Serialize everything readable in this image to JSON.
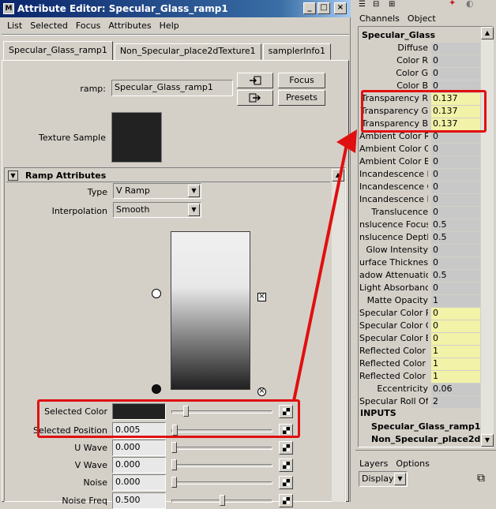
{
  "window": {
    "title": "Attribute Editor: Specular_Glass_ramp1",
    "caption_buttons": [
      "_",
      "□",
      "×"
    ]
  },
  "menu": [
    "List",
    "Selected",
    "Focus",
    "Attributes",
    "Help"
  ],
  "tabs": [
    "Specular_Glass_ramp1",
    "Non_Specular_place2dTexture1",
    "samplerInfo1"
  ],
  "node": {
    "name_label": "ramp:",
    "name_value": "Specular_Glass_ramp1",
    "focus_label": "Focus",
    "presets_label": "Presets",
    "texture_sample_label": "Texture Sample"
  },
  "ramp_attributes": {
    "section_title": "Ramp Attributes",
    "type_label": "Type",
    "type_value": "V Ramp",
    "interpolation_label": "Interpolation",
    "interpolation_value": "Smooth"
  },
  "sliders": [
    {
      "label": "Selected Color",
      "value": "",
      "fraction": 0.12
    },
    {
      "label": "Selected Position",
      "value": "0.005",
      "fraction": 0.005
    },
    {
      "label": "U Wave",
      "value": "0.000",
      "fraction": 0
    },
    {
      "label": "V Wave",
      "value": "0.000",
      "fraction": 0
    },
    {
      "label": "Noise",
      "value": "0.000",
      "fraction": 0
    },
    {
      "label": "Noise Freq",
      "value": "0.500",
      "fraction": 0.5
    }
  ],
  "channel_box": {
    "menu": [
      "Channels",
      "Object"
    ],
    "node_name": "Specular_Glass",
    "channels": [
      {
        "name": "Diffuse",
        "value": "0",
        "hl": false
      },
      {
        "name": "Color R",
        "value": "0",
        "hl": false
      },
      {
        "name": "Color G",
        "value": "0",
        "hl": false
      },
      {
        "name": "Color B",
        "value": "0",
        "hl": false
      },
      {
        "name": "Transparency R",
        "value": "0.137",
        "hl": true
      },
      {
        "name": "Transparency G",
        "value": "0.137",
        "hl": true
      },
      {
        "name": "Transparency B",
        "value": "0.137",
        "hl": true
      },
      {
        "name": "Ambient Color R",
        "value": "0",
        "hl": false
      },
      {
        "name": "Ambient Color G",
        "value": "0",
        "hl": false
      },
      {
        "name": "Ambient Color B",
        "value": "0",
        "hl": false
      },
      {
        "name": "Incandescence R",
        "value": "0",
        "hl": false
      },
      {
        "name": "Incandescence G",
        "value": "0",
        "hl": false
      },
      {
        "name": "Incandescence B",
        "value": "0",
        "hl": false
      },
      {
        "name": "Translucence",
        "value": "0",
        "hl": false
      },
      {
        "name": "nslucence Focus",
        "value": "0.5",
        "hl": false
      },
      {
        "name": "nslucence Depth",
        "value": "0.5",
        "hl": false
      },
      {
        "name": "Glow Intensity",
        "value": "0",
        "hl": false
      },
      {
        "name": "urface Thickness",
        "value": "0",
        "hl": false
      },
      {
        "name": "adow Attenuation",
        "value": "0.5",
        "hl": false
      },
      {
        "name": "Light Absorbance",
        "value": "0",
        "hl": false
      },
      {
        "name": "Matte Opacity",
        "value": "1",
        "hl": false
      },
      {
        "name": "Specular Color R",
        "value": "0",
        "hl": true
      },
      {
        "name": "Specular Color G",
        "value": "0",
        "hl": true
      },
      {
        "name": "Specular Color B",
        "value": "0",
        "hl": true
      },
      {
        "name": "Reflected Color R",
        "value": "1",
        "hl": true
      },
      {
        "name": "Reflected Color G",
        "value": "1",
        "hl": true
      },
      {
        "name": "Reflected Color B",
        "value": "1",
        "hl": true
      },
      {
        "name": "Eccentricity",
        "value": "0.06",
        "hl": false
      },
      {
        "name": "Specular Roll Off",
        "value": "2",
        "hl": false
      }
    ],
    "inputs_label": "INPUTS",
    "inputs": [
      "Specular_Glass_ramp1",
      "Non_Specular_place2d"
    ]
  },
  "layers": {
    "menu": [
      "Layers",
      "Options"
    ],
    "display_value": "Display"
  },
  "colors": {
    "highlight_value": "#f2f2a8",
    "annotation_red": "#e01010",
    "swatch": "#222222"
  }
}
